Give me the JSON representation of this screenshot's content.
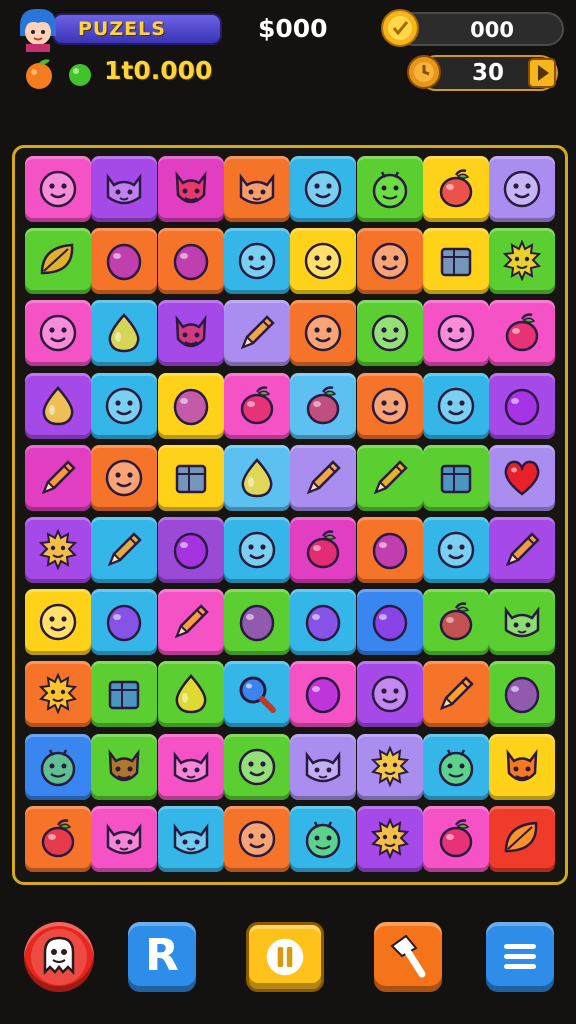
{
  "hud": {
    "title": "PUZELS",
    "money": "$000",
    "coins": "000",
    "score": "1t0.000",
    "moves": "30",
    "icons": {
      "avatar": "player-avatar",
      "coin": "coin-icon",
      "fruit": "orange-fruit-icon",
      "gem": "green-gem-icon",
      "clock": "timer-icon",
      "play": "play-icon"
    }
  },
  "board": {
    "tile_colors": {
      "pk": "#f552c6",
      "pu": "#a54ae8",
      "mg": "#e23ec2",
      "or": "#f5742a",
      "cy": "#34b7e8",
      "gr": "#5bcf31",
      "ye": "#ffd21a",
      "bl": "#3a86f0",
      "rd": "#f03a2a",
      "lb": "#5cc0f0",
      "lv": "#a98ef0",
      "vi": "#9b4ad8"
    },
    "rows": [
      [
        {
          "c": "pk",
          "i": "face"
        },
        {
          "c": "pu",
          "i": "cat"
        },
        {
          "c": "mg",
          "i": "devil"
        },
        {
          "c": "or",
          "i": "cat"
        },
        {
          "c": "cy",
          "i": "face"
        },
        {
          "c": "gr",
          "i": "bug"
        },
        {
          "c": "ye",
          "i": "fruit"
        },
        {
          "c": "lv",
          "i": "face"
        }
      ],
      [
        {
          "c": "gr",
          "i": "leaf"
        },
        {
          "c": "or",
          "i": "blob"
        },
        {
          "c": "or",
          "i": "blob"
        },
        {
          "c": "cy",
          "i": "face"
        },
        {
          "c": "ye",
          "i": "face"
        },
        {
          "c": "or",
          "i": "face"
        },
        {
          "c": "ye",
          "i": "box"
        },
        {
          "c": "gr",
          "i": "sun"
        }
      ],
      [
        {
          "c": "pk",
          "i": "face"
        },
        {
          "c": "cy",
          "i": "drop"
        },
        {
          "c": "pu",
          "i": "devil"
        },
        {
          "c": "lv",
          "i": "pencil"
        },
        {
          "c": "or",
          "i": "face"
        },
        {
          "c": "gr",
          "i": "face"
        },
        {
          "c": "pk",
          "i": "face"
        },
        {
          "c": "pk",
          "i": "fruit"
        }
      ],
      [
        {
          "c": "pu",
          "i": "drop"
        },
        {
          "c": "cy",
          "i": "face"
        },
        {
          "c": "ye",
          "i": "blob"
        },
        {
          "c": "pk",
          "i": "fruit"
        },
        {
          "c": "lb",
          "i": "fruit"
        },
        {
          "c": "or",
          "i": "face"
        },
        {
          "c": "cy",
          "i": "face"
        },
        {
          "c": "pu",
          "i": "blob"
        }
      ],
      [
        {
          "c": "mg",
          "i": "pencil"
        },
        {
          "c": "or",
          "i": "face"
        },
        {
          "c": "ye",
          "i": "box"
        },
        {
          "c": "lb",
          "i": "drop"
        },
        {
          "c": "lv",
          "i": "pencil"
        },
        {
          "c": "gr",
          "i": "pencil"
        },
        {
          "c": "gr",
          "i": "box"
        },
        {
          "c": "lv",
          "i": "heart"
        }
      ],
      [
        {
          "c": "pu",
          "i": "sun"
        },
        {
          "c": "cy",
          "i": "pencil"
        },
        {
          "c": "vi",
          "i": "blob"
        },
        {
          "c": "cy",
          "i": "face"
        },
        {
          "c": "mg",
          "i": "fruit"
        },
        {
          "c": "or",
          "i": "blob"
        },
        {
          "c": "cy",
          "i": "face"
        },
        {
          "c": "pu",
          "i": "pencil"
        }
      ],
      [
        {
          "c": "ye",
          "i": "face"
        },
        {
          "c": "cy",
          "i": "blob"
        },
        {
          "c": "pk",
          "i": "pencil"
        },
        {
          "c": "gr",
          "i": "blob"
        },
        {
          "c": "cy",
          "i": "blob"
        },
        {
          "c": "bl",
          "i": "blob"
        },
        {
          "c": "gr",
          "i": "fruit"
        },
        {
          "c": "gr",
          "i": "cat"
        }
      ],
      [
        {
          "c": "or",
          "i": "sun"
        },
        {
          "c": "gr",
          "i": "box"
        },
        {
          "c": "gr",
          "i": "drop"
        },
        {
          "c": "cy",
          "i": "magnifier"
        },
        {
          "c": "pk",
          "i": "blob"
        },
        {
          "c": "pu",
          "i": "face"
        },
        {
          "c": "or",
          "i": "pencil"
        },
        {
          "c": "gr",
          "i": "blob"
        }
      ],
      [
        {
          "c": "bl",
          "i": "bug"
        },
        {
          "c": "gr",
          "i": "devil"
        },
        {
          "c": "pk",
          "i": "cat"
        },
        {
          "c": "gr",
          "i": "face"
        },
        {
          "c": "lv",
          "i": "cat"
        },
        {
          "c": "lv",
          "i": "sun"
        },
        {
          "c": "cy",
          "i": "bug"
        },
        {
          "c": "ye",
          "i": "devil"
        }
      ],
      [
        {
          "c": "or",
          "i": "fruit"
        },
        {
          "c": "pk",
          "i": "cat"
        },
        {
          "c": "cy",
          "i": "cat"
        },
        {
          "c": "or",
          "i": "face"
        },
        {
          "c": "cy",
          "i": "bug"
        },
        {
          "c": "pu",
          "i": "sun"
        },
        {
          "c": "pk",
          "i": "fruit"
        },
        {
          "c": "rd",
          "i": "leaf"
        }
      ]
    ]
  },
  "controls": [
    {
      "name": "ghost-button",
      "icon": "ghost-icon",
      "color": "#e8261e",
      "label": ""
    },
    {
      "name": "restart-button",
      "icon": "r-icon",
      "color": "#2d8de8",
      "label": "R"
    },
    {
      "name": "pause-button",
      "icon": "pause-icon",
      "color": "#ffc21a",
      "label": ""
    },
    {
      "name": "hammer-button",
      "icon": "hammer-icon",
      "color": "#f5741a",
      "label": ""
    },
    {
      "name": "menu-button",
      "icon": "menu-icon",
      "color": "#2d8de8",
      "label": ""
    }
  ]
}
